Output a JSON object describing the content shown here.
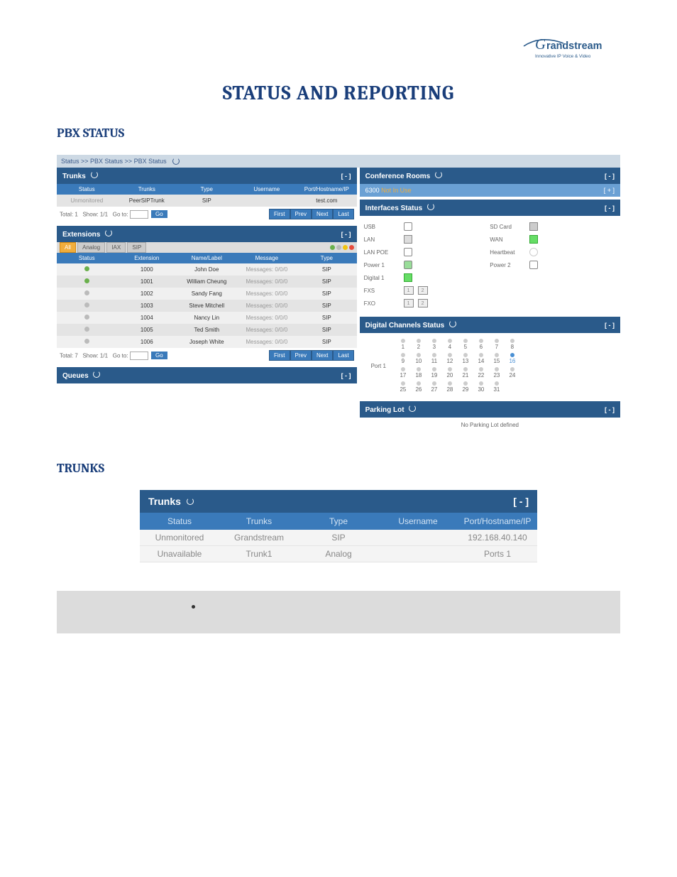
{
  "logo_tagline": "Innovative IP Voice & Video",
  "page_title": "STATUS AND REPORTING",
  "sections": {
    "pbx_status": "PBX STATUS",
    "trunks": "TRUNKS"
  },
  "breadcrumb": "Status >> PBX Status >> PBX Status",
  "trunks_panel": {
    "title": "Trunks",
    "collapse": "[ - ]",
    "columns": {
      "status": "Status",
      "trunks": "Trunks",
      "type": "Type",
      "username": "Username",
      "port": "Port/Hostname/IP"
    },
    "rows": [
      {
        "status": "Unmonitored",
        "trunks": "PeerSIPTrunk",
        "type": "SIP",
        "username": "",
        "port": "test.com"
      }
    ],
    "pager": {
      "total": "Total: 1",
      "show": "Show: 1/1",
      "goto": "Go to:",
      "go": "Go",
      "first": "First",
      "prev": "Prev",
      "next": "Next",
      "last": "Last"
    }
  },
  "extensions_panel": {
    "title": "Extensions",
    "collapse": "[ - ]",
    "tabs": {
      "all": "All",
      "analog": "Analog",
      "iax": "IAX",
      "sip": "SIP"
    },
    "columns": {
      "status": "Status",
      "extension": "Extension",
      "name": "Name/Label",
      "message": "Message",
      "type": "Type"
    },
    "rows": [
      {
        "dot": "green",
        "extension": "1000",
        "name": "John Doe",
        "message": "Messages: 0/0/0",
        "type": "SIP",
        "bg": "even"
      },
      {
        "dot": "green",
        "extension": "1001",
        "name": "William Cheung",
        "message": "Messages: 0/0/0",
        "type": "SIP",
        "bg": "odd"
      },
      {
        "dot": "grey",
        "extension": "1002",
        "name": "Sandy Fang",
        "message": "Messages: 0/0/0",
        "type": "SIP",
        "bg": "even"
      },
      {
        "dot": "grey",
        "extension": "1003",
        "name": "Steve Mitchell",
        "message": "Messages: 0/0/0",
        "type": "SIP",
        "bg": "odd"
      },
      {
        "dot": "grey",
        "extension": "1004",
        "name": "Nancy Lin",
        "message": "Messages: 0/0/0",
        "type": "SIP",
        "bg": "even"
      },
      {
        "dot": "grey",
        "extension": "1005",
        "name": "Ted Smith",
        "message": "Messages: 0/0/0",
        "type": "SIP",
        "bg": "odd"
      },
      {
        "dot": "grey",
        "extension": "1006",
        "name": "Joseph White",
        "message": "Messages: 0/0/0",
        "type": "SIP",
        "bg": "even"
      }
    ],
    "pager": {
      "total": "Total: 7",
      "show": "Show: 1/1",
      "goto": "Go to:",
      "go": "Go",
      "first": "First",
      "prev": "Prev",
      "next": "Next",
      "last": "Last"
    }
  },
  "queues_panel": {
    "title": "Queues",
    "collapse": "[ - ]"
  },
  "conference_panel": {
    "title": "Conference Rooms",
    "collapse": "[ - ]",
    "room": "6300",
    "status": "Not In Use",
    "expand": "[ + ]"
  },
  "interfaces_panel": {
    "title": "Interfaces Status",
    "collapse": "[ - ]",
    "rows": [
      {
        "l": "USB",
        "r": "SD Card"
      },
      {
        "l": "LAN",
        "r": "WAN"
      },
      {
        "l": "LAN POE",
        "r": "Heartbeat"
      },
      {
        "l": "Power 1",
        "r": "Power 2"
      },
      {
        "l": "Digital 1",
        "r": ""
      },
      {
        "l": "FXS",
        "r": "",
        "ports": [
          "1",
          "2"
        ]
      },
      {
        "l": "FXO",
        "r": "",
        "ports": [
          "1",
          "2"
        ]
      }
    ]
  },
  "digital_panel": {
    "title": "Digital Channels Status",
    "collapse": "[ - ]",
    "port_label": "Port 1",
    "grid": [
      [
        1,
        2,
        3,
        4,
        5,
        6,
        7,
        8
      ],
      [
        9,
        10,
        11,
        12,
        13,
        14,
        15,
        16
      ],
      [
        17,
        18,
        19,
        20,
        21,
        22,
        23,
        24
      ],
      [
        25,
        26,
        27,
        28,
        29,
        30,
        31
      ]
    ],
    "highlighted": [
      16
    ]
  },
  "parking_panel": {
    "title": "Parking Lot",
    "collapse": "[ - ]",
    "empty": "No Parking Lot defined"
  },
  "trunks_zoom": {
    "title": "Trunks",
    "collapse": "[ - ]",
    "columns": {
      "status": "Status",
      "trunks": "Trunks",
      "type": "Type",
      "username": "Username",
      "port": "Port/Hostname/IP"
    },
    "rows": [
      {
        "status": "Unmonitored",
        "trunks": "Grandstream",
        "type": "SIP",
        "username": "",
        "port": "192.168.40.140"
      },
      {
        "status": "Unavailable",
        "trunks": "Trunk1",
        "type": "Analog",
        "username": "",
        "port": "Ports 1"
      }
    ]
  }
}
